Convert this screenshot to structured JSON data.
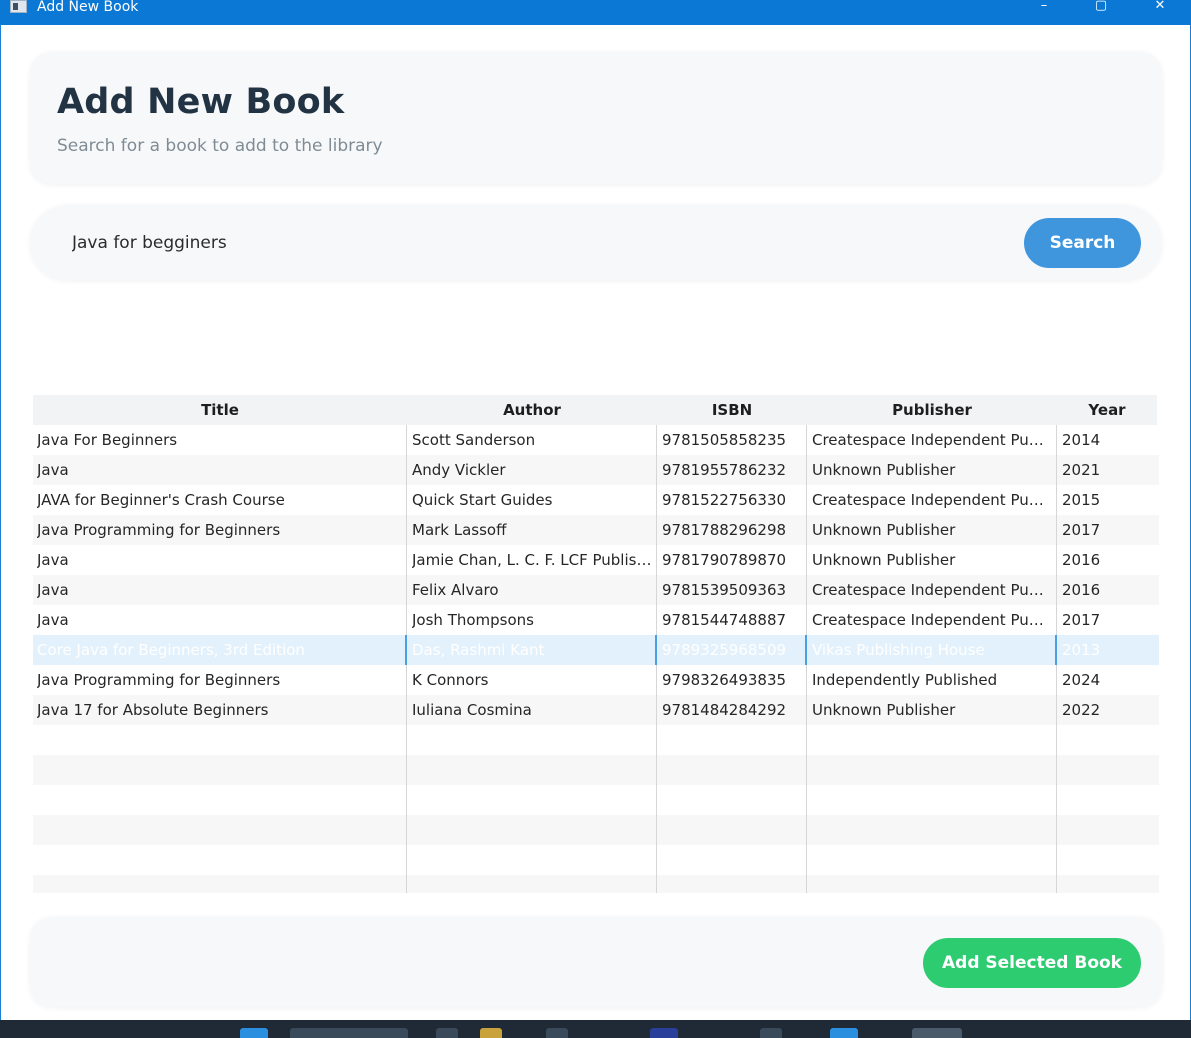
{
  "window": {
    "title": "Add New Book"
  },
  "header": {
    "title": "Add New Book",
    "subtitle": "Search for a book to add to the library"
  },
  "search": {
    "query": "Java for begginers",
    "button_label": "Search"
  },
  "table": {
    "columns": [
      "Title",
      "Author",
      "ISBN",
      "Publisher",
      "Year"
    ],
    "rows": [
      [
        "Java For Beginners",
        "Scott Sanderson",
        "9781505858235",
        "Createspace Independent Publishing Platform",
        "2014"
      ],
      [
        "Java",
        "Andy Vickler",
        "9781955786232",
        "Unknown Publisher",
        "2021"
      ],
      [
        "JAVA for Beginner's Crash Course",
        "Quick Start Guides",
        "9781522756330",
        "Createspace Independent Publishing Platform",
        "2015"
      ],
      [
        "Java Programming for Beginners",
        "Mark Lassoff",
        "9781788296298",
        "Unknown Publisher",
        "2017"
      ],
      [
        "Java",
        "Jamie Chan, L. C. F. LCF Publishing",
        "9781790789870",
        "Unknown Publisher",
        "2016"
      ],
      [
        "Java",
        "Felix Alvaro",
        "9781539509363",
        "Createspace Independent Publishing Platform",
        "2016"
      ],
      [
        "Java",
        "Josh Thompsons",
        "9781544748887",
        "Createspace Independent Publishing Platform",
        "2017"
      ],
      [
        "Core Java for Beginners, 3rd Edition",
        "Das, Rashmi Kant",
        "9789325968509",
        "Vikas Publishing House",
        "2013"
      ],
      [
        "Java Programming for Beginners",
        "K Connors",
        "9798326493835",
        "Independently Published",
        "2024"
      ],
      [
        "Java 17 for Absolute Beginners",
        "Iuliana Cosmina",
        "9781484284292",
        "Unknown Publisher",
        "2022"
      ]
    ],
    "selected_row": 7
  },
  "footer": {
    "add_button_label": "Add Selected Book"
  },
  "colors": {
    "titlebar": "#0a78d4",
    "search_button": "#3f96dd",
    "add_button": "#2ecc71",
    "selection": "#e3f1fc"
  }
}
